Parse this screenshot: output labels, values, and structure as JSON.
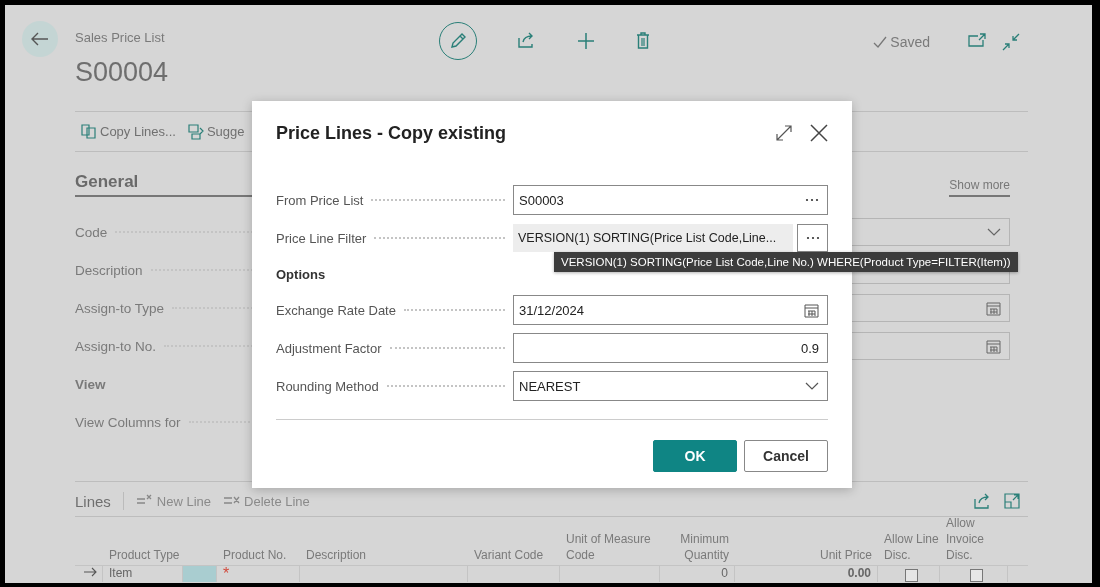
{
  "page": {
    "breadcrumb": "Sales Price List",
    "title": "S00004",
    "status": "Saved"
  },
  "actions": [
    {
      "label": "Copy Lines..."
    },
    {
      "label": "Sugge"
    }
  ],
  "general": {
    "heading": "General",
    "show_more": "Show more",
    "left_fields": [
      {
        "kind": "field",
        "label": "Code"
      },
      {
        "kind": "field",
        "label": "Description"
      },
      {
        "kind": "field",
        "label": "Assign-to Type"
      },
      {
        "kind": "field",
        "label": "Assign-to No."
      },
      {
        "kind": "group",
        "label": "View"
      },
      {
        "kind": "field",
        "label": "View Columns for"
      }
    ],
    "right_fields": [
      {
        "kind": "select"
      },
      {
        "kind": "text"
      },
      {
        "kind": "date"
      },
      {
        "kind": "date"
      }
    ]
  },
  "lines": {
    "heading": "Lines",
    "actions": [
      {
        "label": "New Line",
        "disabled": true
      },
      {
        "label": "Delete Line",
        "disabled": true
      }
    ],
    "columns": [
      "Product Type",
      "Product No.",
      "Description",
      "Variant Code",
      "Unit of Measure Code",
      "Minimum Quantity",
      "Unit Price",
      "Allow Line Disc.",
      "Allow Invoice Disc."
    ],
    "rows": [
      {
        "product_type": "Item",
        "required_mark": "*",
        "minimum_quantity": "0",
        "unit_price": "0.00",
        "allow_line_disc": false,
        "allow_invoice_disc": false
      }
    ]
  },
  "dialog": {
    "title": "Price Lines - Copy existing",
    "fields": [
      {
        "kind": "lookup",
        "label": "From Price List",
        "value": "S00003"
      },
      {
        "kind": "filter",
        "label": "Price Line Filter",
        "value": "VERSION(1) SORTING(Price List Code,Line..."
      },
      {
        "kind": "heading",
        "label": "Options"
      },
      {
        "kind": "date",
        "label": "Exchange Rate Date",
        "value": "31/12/2024"
      },
      {
        "kind": "number",
        "label": "Adjustment Factor",
        "value": "0.9"
      },
      {
        "kind": "select",
        "label": "Rounding Method",
        "value": "NEAREST"
      }
    ],
    "buttons": [
      {
        "label": "OK",
        "primary": true
      },
      {
        "label": "Cancel",
        "primary": false
      }
    ]
  },
  "tooltip": "VERSION(1) SORTING(Price List Code,Line No.) WHERE(Product Type=FILTER(Item))"
}
